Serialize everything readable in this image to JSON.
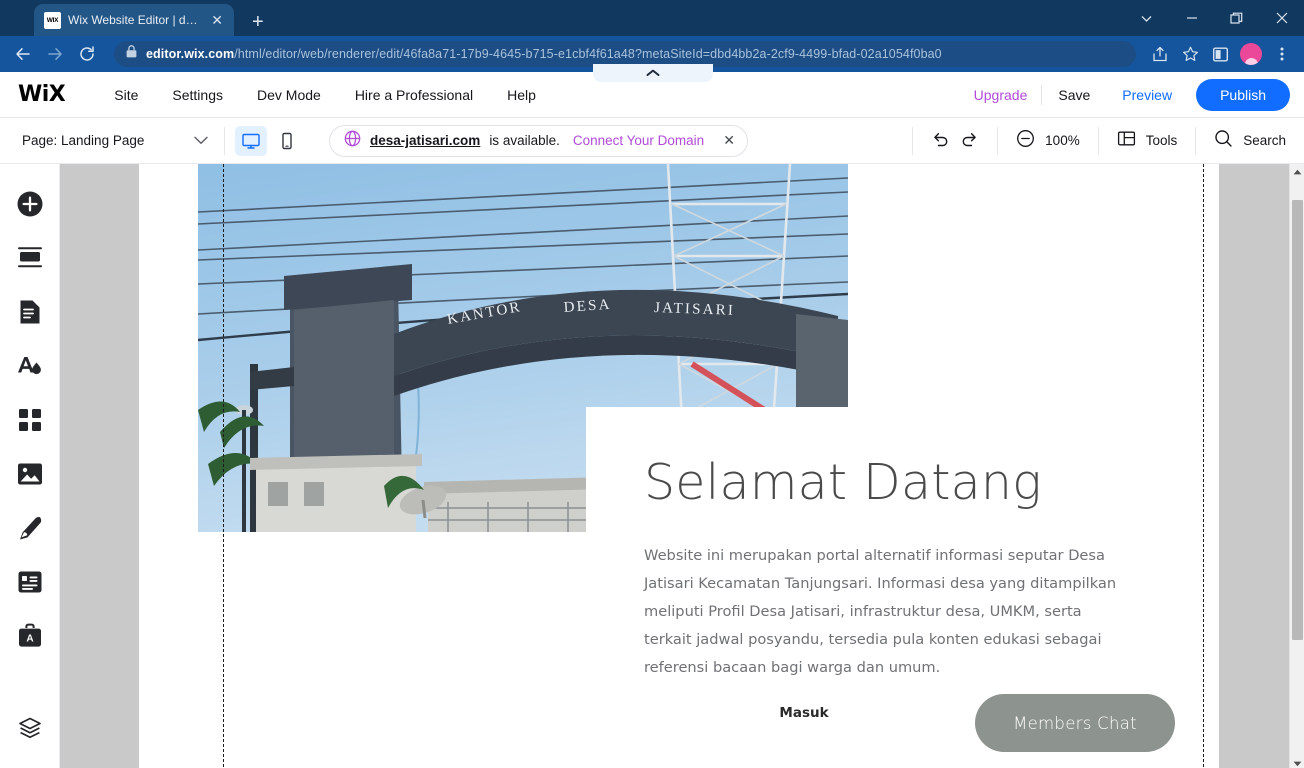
{
  "browser": {
    "tab": {
      "title": "Wix Website Editor | desa-jatisari",
      "favicon_text": "WIX",
      "close_label": "✕",
      "newtab_label": "+"
    },
    "window_controls": {
      "chevron": "chevron-down",
      "minimize": "—",
      "maximize": "❐",
      "close": "✕"
    },
    "nav": {
      "back": "←",
      "forward": "→",
      "reload": "↻"
    },
    "url_bold": "editor.wix.com",
    "url_rest": "/html/editor/web/renderer/edit/46fa8a71-17b9-4645-b715-e1cbf4f61a48?metaSiteId=dbd4bb2a-2cf9-4499-bfad-02a1054f0ba0",
    "actions": {
      "share": "share-icon",
      "bookmark": "star-icon",
      "sidepanel": "side-panel-icon",
      "profile": "avatar-icon",
      "menu": "⋮"
    },
    "collapse_tab": "collapse-toolbar-chevron-up"
  },
  "wix_topbar": {
    "logo": "WiX",
    "menus": [
      "Site",
      "Settings",
      "Dev Mode",
      "Hire a Professional",
      "Help"
    ],
    "upgrade_label": "Upgrade",
    "save_label": "Save",
    "preview_label": "Preview",
    "publish_label": "Publish",
    "publish_color": "#116dff",
    "upgrade_color": "#b14bd8"
  },
  "wix_subbar": {
    "page_label": "Page: Landing Page",
    "view_desktop": "desktop-icon",
    "view_mobile": "mobile-icon",
    "domain": {
      "icon": "globe-icon",
      "name": "desa-jatisari.com",
      "status": "is available.",
      "cta": "Connect Your Domain",
      "close": "✕",
      "accent": "#b14bd8"
    },
    "undo": "undo-icon",
    "redo": "redo-icon",
    "zoom_out_icon": "zoom-out-icon",
    "zoom_level": "100%",
    "tools_icon": "panels-icon",
    "tools_label": "Tools",
    "search_icon": "search-icon",
    "search_label": "Search"
  },
  "left_rail": {
    "items": [
      {
        "name": "add-element-icon",
        "label": "Add"
      },
      {
        "name": "add-section-icon",
        "label": "Add Section"
      },
      {
        "name": "pages-menu-icon",
        "label": "Pages & Menu"
      },
      {
        "name": "site-design-icon",
        "label": "Site Design"
      },
      {
        "name": "apps-icon",
        "label": "App Market"
      },
      {
        "name": "media-icon",
        "label": "My Business / Media"
      },
      {
        "name": "blog-icon",
        "label": "Blog"
      },
      {
        "name": "content-manager-icon",
        "label": "Content Manager"
      },
      {
        "name": "business-tools-icon",
        "label": "Business Tools"
      }
    ],
    "bottom": {
      "name": "layers-icon",
      "label": "Layers"
    }
  },
  "canvas": {
    "photo": {
      "alt": "Kantor Desa Jatisari gate photo",
      "sign_text": "KANTOR  DESA  JATISARI"
    },
    "hero": {
      "title": "Selamat Datang",
      "body": "Website ini merupakan portal alternatif informasi seputar Desa Jatisari Kecamatan Tanjungsari. Informasi desa yang ditampilkan meliputi Profil Desa Jatisari, infrastruktur desa, UMKM, serta terkait jadwal posyandu, tersedia pula konten edukasi sebagai referensi bacaan bagi warga dan umum.",
      "cta": "Masuk"
    },
    "chat_widget": {
      "label": "Members Chat",
      "color": "#8d938e"
    },
    "scrollbar": {
      "up": "scroll-up-arrow",
      "down": "scroll-down-arrow"
    }
  }
}
